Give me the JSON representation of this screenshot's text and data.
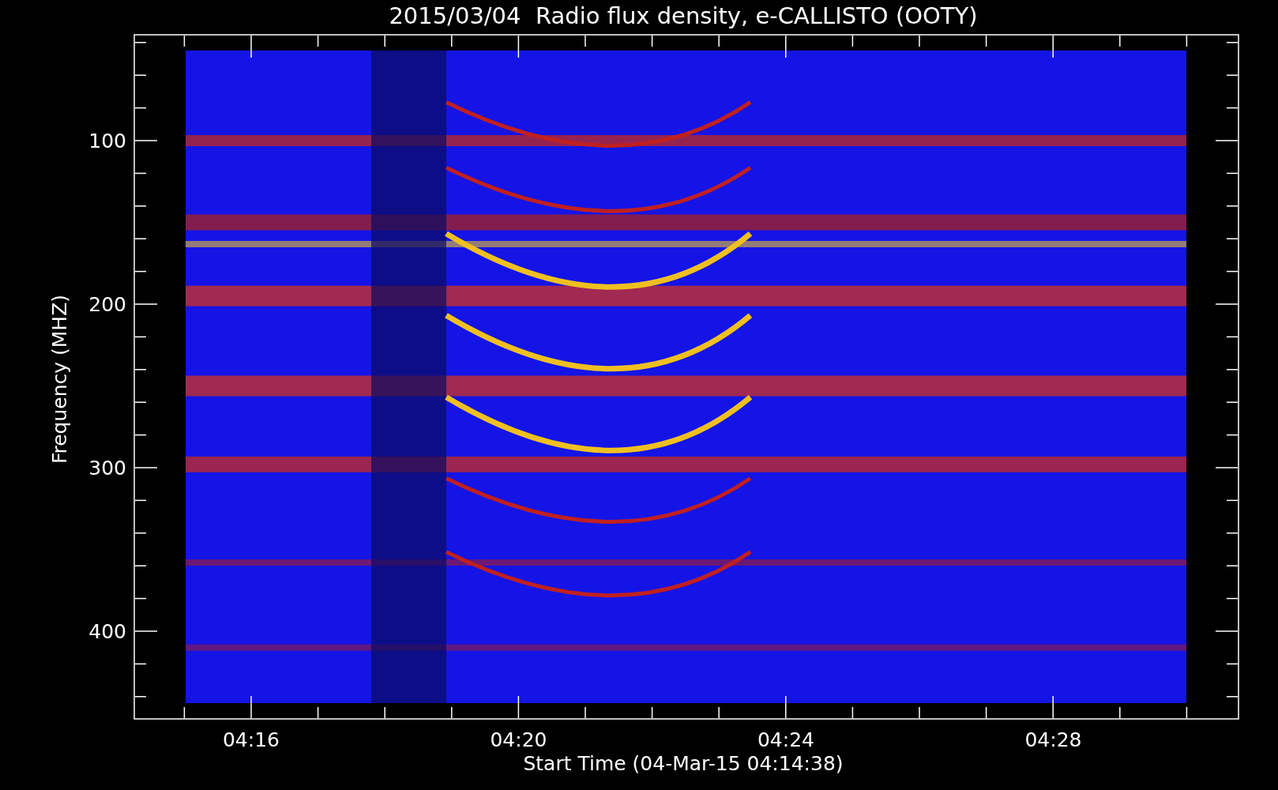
{
  "title": "2015/03/04  Radio flux density, e-CALLISTO (OOTY)",
  "y_axis": {
    "label": "Frequency (MHZ)",
    "tick_labels": [
      "100",
      "200",
      "300",
      "400"
    ]
  },
  "x_axis": {
    "label": "Start Time (04-Mar-15 04:14:38)",
    "tick_labels": [
      "04:16",
      "04:20",
      "04:24",
      "04:28"
    ]
  }
}
